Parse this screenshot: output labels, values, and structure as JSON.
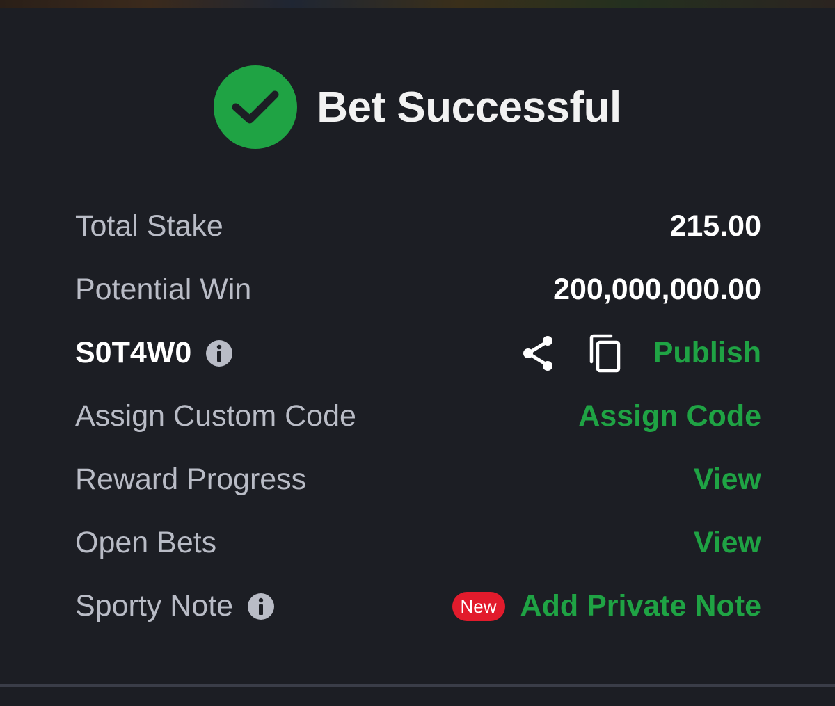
{
  "header": {
    "title": "Bet Successful",
    "icon": "check-circle-icon",
    "accent_color": "#1fa344"
  },
  "rows": {
    "total_stake": {
      "label": "Total Stake",
      "value": "215.00"
    },
    "potential_win": {
      "label": "Potential Win",
      "value": "200,000,000.00"
    },
    "booking_code": {
      "code": "S0T4W0",
      "publish_label": "Publish"
    },
    "custom_code": {
      "label": "Assign Custom Code",
      "action": "Assign Code"
    },
    "reward_progress": {
      "label": "Reward Progress",
      "action": "View"
    },
    "open_bets": {
      "label": "Open Bets",
      "action": "View"
    },
    "sporty_note": {
      "label": "Sporty Note",
      "badge": "New",
      "action": "Add Private Note",
      "badge_color": "#e21b2c"
    }
  }
}
